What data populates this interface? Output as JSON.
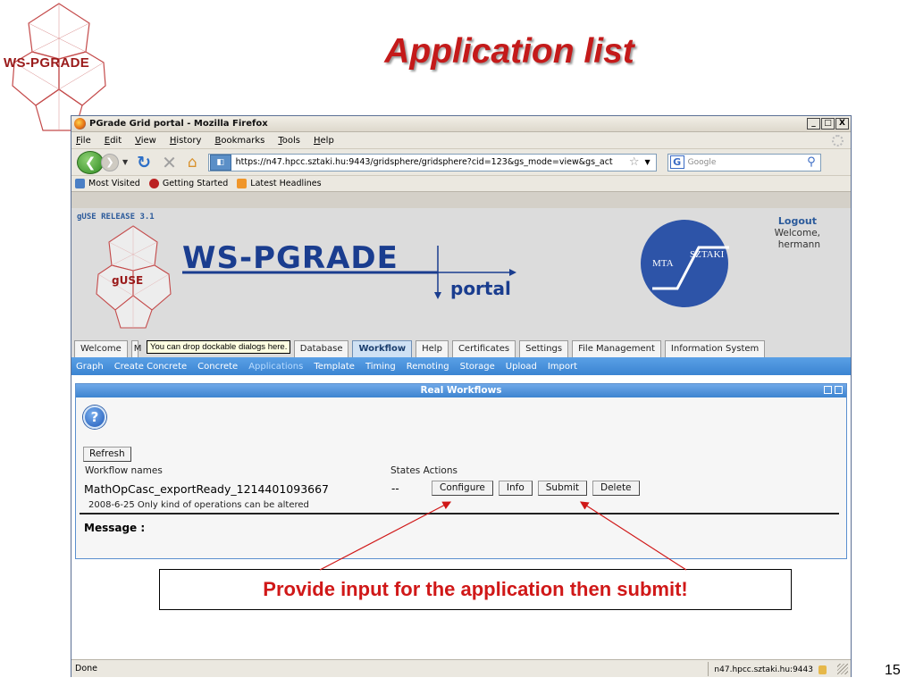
{
  "slide": {
    "logo_text": "WS-PGRADE",
    "title": "Application list",
    "page_number": "15",
    "callout": "Provide input for the application then submit!"
  },
  "browser": {
    "window_title": "PGrade Grid portal - Mozilla Firefox",
    "window_buttons": [
      "_",
      "□",
      "X"
    ],
    "menu": [
      "File",
      "Edit",
      "View",
      "History",
      "Bookmarks",
      "Tools",
      "Help"
    ],
    "url": "https://n47.hpcc.sztaki.hu:9443/gridsphere/gridsphere?cid=123&gs_mode=view&gs_act",
    "search_placeholder": "Google",
    "bookmarks": [
      "Most Visited",
      "Getting Started",
      "Latest Headlines"
    ],
    "status_text": "Done",
    "status_host": "n47.hpcc.sztaki.hu:9443"
  },
  "portal": {
    "release": "gUSE RELEASE 3.1",
    "guse_logo_text": "gUSE",
    "brand": "WS-PGRADE",
    "brand_sub": "portal",
    "partner_left": "MTA",
    "partner_right": "SZTAKI",
    "logout": "Logout",
    "welcome": "Welcome,",
    "user": "hermann",
    "tabs": [
      {
        "label": "Welcome",
        "active": false
      },
      {
        "label": "M",
        "active": false
      },
      {
        "label": "Database",
        "active": false
      },
      {
        "label": "Workflow",
        "active": true
      },
      {
        "label": "Help",
        "active": false
      },
      {
        "label": "Certificates",
        "active": false
      },
      {
        "label": "Settings",
        "active": false
      },
      {
        "label": "File Management",
        "active": false
      },
      {
        "label": "Information System",
        "active": false
      }
    ],
    "tooltip": "You can drop dockable dialogs here.",
    "subnav": [
      "Graph",
      "Create Concrete",
      "Concrete",
      "Applications",
      "Template",
      "Timing",
      "Remoting",
      "Storage",
      "Upload",
      "Import"
    ],
    "subnav_selected": "Applications"
  },
  "portlet": {
    "title": "Real Workflows",
    "refresh": "Refresh",
    "col_names": "Workflow names",
    "col_states": "States Actions",
    "workflow_name": "MathOpCasc_exportReady_1214401093667",
    "workflow_state": "--",
    "actions": [
      "Configure",
      "Info",
      "Submit",
      "Delete"
    ],
    "workflow_info": "2008-6-25 Only kind of operations can be altered",
    "message_label": "Message :"
  },
  "colors": {
    "title_red": "#c41a1a",
    "portal_blue": "#2b5a9b",
    "subnav_blue": "#3b84d2",
    "callout_red": "#d01818"
  }
}
